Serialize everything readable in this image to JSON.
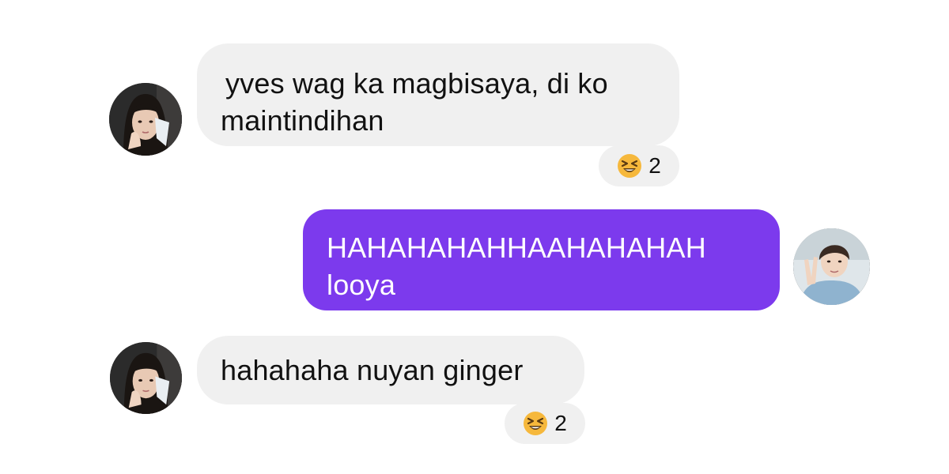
{
  "conversation": {
    "messages": [
      {
        "sender": "other",
        "lines": [
          "yves wag ka magbisaya, di ko",
          "maintindihan"
        ],
        "reaction": {
          "emoji": "laughing-squint-emoji",
          "count": "2"
        }
      },
      {
        "sender": "me",
        "lines": [
          "HAHAHAHAHHAAHAHAHAH",
          "looya"
        ]
      },
      {
        "sender": "other",
        "lines": [
          "hahahaha nuyan ginger"
        ],
        "reaction": {
          "emoji": "laughing-squint-emoji",
          "count": "2"
        }
      }
    ]
  },
  "colors": {
    "incoming_bubble": "#f0f0f0",
    "outgoing_bubble": "#7c3aed",
    "outgoing_text": "#ffffff",
    "incoming_text": "#111111",
    "background": "#ffffff"
  }
}
